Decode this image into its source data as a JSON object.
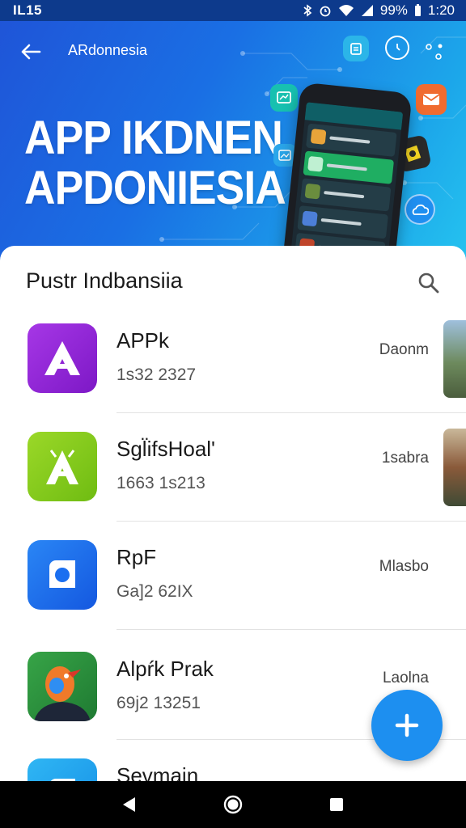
{
  "status_bar": {
    "carrier": "IL15",
    "battery": "99%",
    "time": "1:20"
  },
  "header": {
    "nav_title": "ARdonnesia",
    "headline_line1": "APP IKDNEN",
    "headline_line2": "APDONIESIA"
  },
  "section": {
    "title": "Pustr Indbansiia"
  },
  "apps": [
    {
      "name": "APPk",
      "meta": "1s32  2327",
      "tag": "Daonm",
      "icon": "purple-a-icon",
      "color": "#9b27d8"
    },
    {
      "name": "Sgl̈ifsHoal'",
      "meta": "1663  1s213",
      "tag": "1sabra",
      "icon": "green-a-icon",
      "color": "#8bd21a"
    },
    {
      "name": "RpF",
      "meta": "Ga]2  62IX",
      "tag": "Mlasbo",
      "icon": "camera-icon",
      "color": "#1b6ff0"
    },
    {
      "name": "Alpŕk Prak",
      "meta": "69j2  13251",
      "tag": "Laolna",
      "icon": "bird-icon",
      "color": "#2e8f3c"
    },
    {
      "name": "Sevmain",
      "meta": "",
      "tag": "",
      "icon": "blue-app-icon",
      "color": "#26a8f0"
    }
  ],
  "colors": {
    "accent": "#1d8ff0",
    "hero_start": "#1f55d8",
    "hero_end": "#25c3ef"
  }
}
